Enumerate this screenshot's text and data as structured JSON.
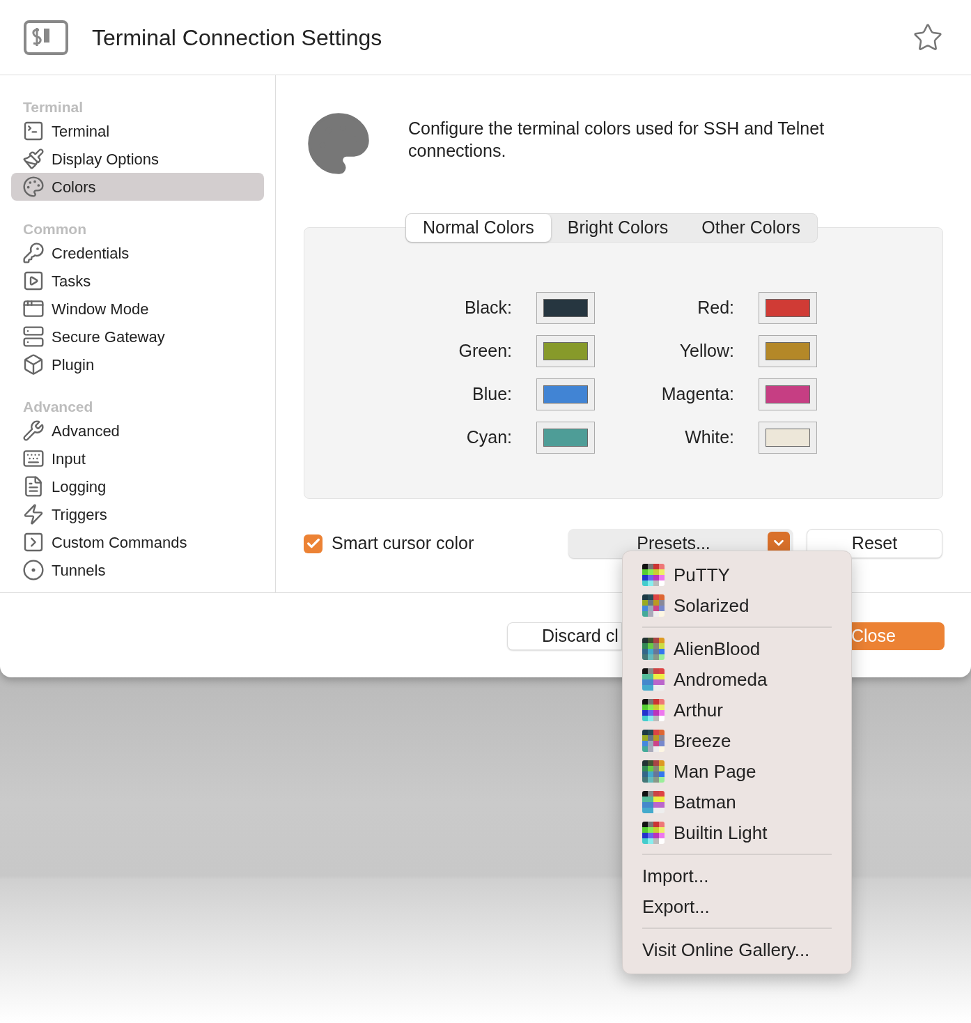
{
  "window": {
    "title": "Terminal Connection Settings",
    "favorite": false
  },
  "sidebar": {
    "sections": [
      {
        "title": "Terminal",
        "items": [
          {
            "label": "Terminal",
            "selected": false
          },
          {
            "label": "Display Options",
            "selected": false
          },
          {
            "label": "Colors",
            "selected": true
          }
        ]
      },
      {
        "title": "Common",
        "items": [
          {
            "label": "Credentials",
            "selected": false
          },
          {
            "label": "Tasks",
            "selected": false
          },
          {
            "label": "Window Mode",
            "selected": false
          },
          {
            "label": "Secure Gateway",
            "selected": false
          },
          {
            "label": "Plugin",
            "selected": false
          }
        ]
      },
      {
        "title": "Advanced",
        "items": [
          {
            "label": "Advanced",
            "selected": false
          },
          {
            "label": "Input",
            "selected": false
          },
          {
            "label": "Logging",
            "selected": false
          },
          {
            "label": "Triggers",
            "selected": false
          },
          {
            "label": "Custom Commands",
            "selected": false
          },
          {
            "label": "Tunnels",
            "selected": false
          }
        ]
      }
    ]
  },
  "content": {
    "description": "Configure the terminal colors used for SSH and Telnet connections.",
    "tabs": [
      {
        "label": "Normal Colors",
        "selected": true
      },
      {
        "label": "Bright Colors",
        "selected": false
      },
      {
        "label": "Other Colors",
        "selected": false
      }
    ],
    "colors": [
      {
        "label": "Black:",
        "color": "#263640"
      },
      {
        "label": "Red:",
        "color": "#d03b35"
      },
      {
        "label": "Green:",
        "color": "#879a2a"
      },
      {
        "label": "Yellow:",
        "color": "#b48828"
      },
      {
        "label": "Blue:",
        "color": "#4184d4"
      },
      {
        "label": "Magenta:",
        "color": "#c63e83"
      },
      {
        "label": "Cyan:",
        "color": "#4e9d97"
      },
      {
        "label": "White:",
        "color": "#ede7d9"
      }
    ],
    "smart_cursor": {
      "label": "Smart cursor color",
      "checked": true
    },
    "presets_button": "Presets...",
    "reset_button": "Reset"
  },
  "footer": {
    "discard_button": "Discard cl",
    "close_button": "Close"
  },
  "presets_menu": {
    "groups": [
      [
        {
          "kind": "preset",
          "label": "PuTTY"
        },
        {
          "kind": "preset",
          "label": "Solarized"
        }
      ],
      [
        {
          "kind": "preset",
          "label": "AlienBlood"
        },
        {
          "kind": "preset",
          "label": "Andromeda"
        },
        {
          "kind": "preset",
          "label": "Arthur"
        },
        {
          "kind": "preset",
          "label": "Breeze"
        },
        {
          "kind": "preset",
          "label": "Man Page"
        },
        {
          "kind": "preset",
          "label": "Batman"
        },
        {
          "kind": "preset",
          "label": "Builtin Light"
        }
      ],
      [
        {
          "kind": "action",
          "label": "Import..."
        },
        {
          "kind": "action",
          "label": "Export..."
        }
      ],
      [
        {
          "kind": "action",
          "label": "Visit Online Gallery..."
        }
      ]
    ]
  }
}
